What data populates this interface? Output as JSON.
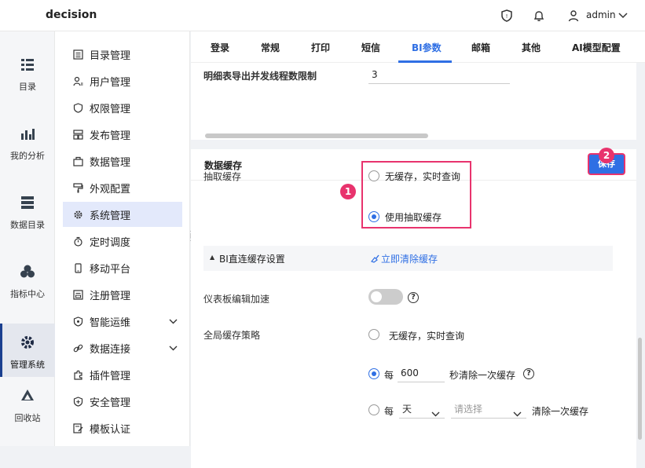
{
  "header": {
    "app_title": "decision",
    "user_name": "admin"
  },
  "left_nav": [
    {
      "label": "目录",
      "icon": "list-icon"
    },
    {
      "label": "我的分析",
      "icon": "chart-icon"
    },
    {
      "label": "数据目录",
      "icon": "database-icon"
    },
    {
      "label": "指标中心",
      "icon": "cubes-icon"
    },
    {
      "label": "管理系统",
      "icon": "gear-icon",
      "active": true
    },
    {
      "label": "回收站",
      "icon": "trash-triangle-icon"
    }
  ],
  "submenu": [
    {
      "label": "目录管理"
    },
    {
      "label": "用户管理"
    },
    {
      "label": "权限管理"
    },
    {
      "label": "发布管理"
    },
    {
      "label": "数据管理"
    },
    {
      "label": "外观配置"
    },
    {
      "label": "系统管理"
    },
    {
      "label": "定时调度"
    },
    {
      "label": "移动平台"
    },
    {
      "label": "注册管理"
    },
    {
      "label": "智能运维"
    },
    {
      "label": "数据连接"
    },
    {
      "label": "插件管理"
    },
    {
      "label": "安全管理"
    },
    {
      "label": "模板认证"
    }
  ],
  "tabs": [
    "登录",
    "常规",
    "打印",
    "短信",
    "BI参数",
    "邮箱",
    "其他",
    "AI模型配置"
  ],
  "active_tab": "BI参数",
  "export": {
    "label": "明细表导出并发线程数限制",
    "value": "3"
  },
  "cache": {
    "title": "数据缓存",
    "save_label": "保存",
    "extract_label": "抽取缓存",
    "option_no_cache": "无缓存，实时查询",
    "option_use_extract": "使用抽取缓存",
    "badge_1": "1",
    "badge_2": "2",
    "direct_section": "BI直连缓存设置",
    "clear_link": "立即清除缓存",
    "dashboard_accel_label": "仪表板编辑加速",
    "global_strategy_label": "全局缓存策略",
    "global_no_cache": "无缓存，实时查询",
    "every_label": "每",
    "interval_value": "600",
    "seconds_clear": "秒清除一次缓存",
    "period_unit": "天",
    "period_placeholder": "请选择",
    "period_clear": "清除一次缓存"
  },
  "accent_color": "#2f6fe4",
  "highlight_color": "#e8336d"
}
